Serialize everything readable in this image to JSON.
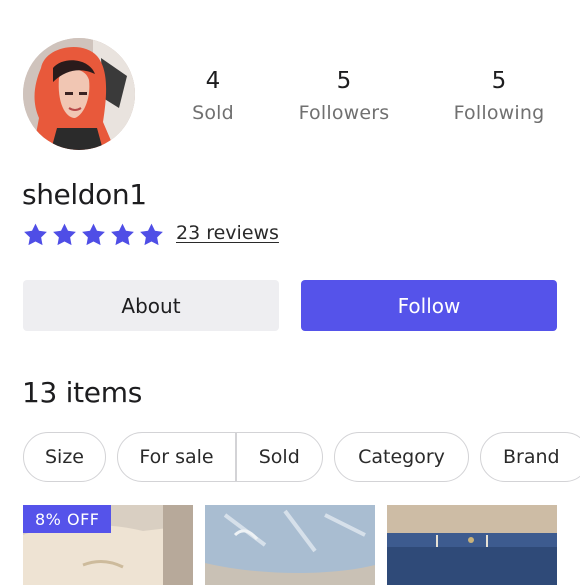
{
  "profile": {
    "username": "sheldon1",
    "reviews_label": "23 reviews",
    "rating": 5,
    "rating_max": 5
  },
  "stats": [
    {
      "value": "4",
      "label": "Sold"
    },
    {
      "value": "5",
      "label": "Followers"
    },
    {
      "value": "5",
      "label": "Following"
    }
  ],
  "actions": {
    "about_label": "About",
    "follow_label": "Follow"
  },
  "items": {
    "count_label": "13 items"
  },
  "filters": {
    "size": "Size",
    "for_sale": "For sale",
    "sold": "Sold",
    "category": "Category",
    "brand": "Brand"
  },
  "listings": [
    {
      "badge": "8% OFF"
    },
    {
      "badge": ""
    },
    {
      "badge": ""
    }
  ],
  "colors": {
    "accent": "#5553ea",
    "star": "#4f4ee6",
    "secondary_button": "#eeeef1"
  },
  "icons": {
    "star": "star-icon"
  }
}
